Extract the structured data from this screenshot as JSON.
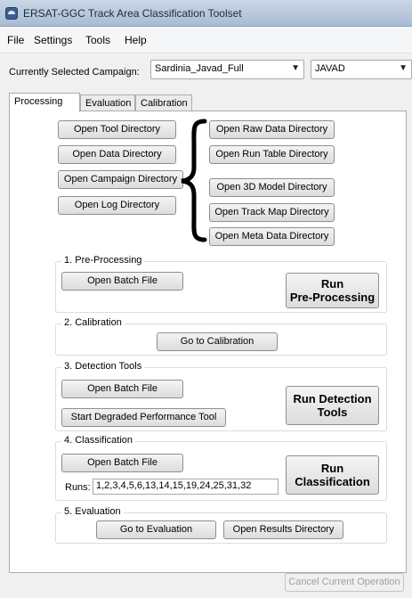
{
  "window": {
    "title": "ERSAT-GGC Track Area Classification Toolset",
    "app_icon": "app-icon"
  },
  "menu": {
    "items": [
      "File",
      "Settings",
      "Tools",
      "Help"
    ]
  },
  "campaign": {
    "label": "Currently Selected Campaign:",
    "selected": "Sardinia_Javad_Full",
    "receiver": "JAVAD"
  },
  "tabs": [
    "Processing",
    "Evaluation",
    "Calibration"
  ],
  "directories": {
    "left": [
      "Open Tool Directory",
      "Open Data Directory",
      "Open Campaign Directory",
      "Open Log Directory"
    ],
    "right": [
      "Open Raw Data Directory",
      "Open Run Table Directory",
      "Open 3D Model Directory",
      "Open Track Map Directory",
      "Open Meta Data Directory"
    ]
  },
  "preprocessing": {
    "title": "1. Pre-Processing",
    "open_batch": "Open Batch File",
    "run": "Run\nPre-Processing"
  },
  "calibration": {
    "title": "2. Calibration",
    "goto": "Go to Calibration"
  },
  "detection": {
    "title": "3. Detection Tools",
    "open_batch": "Open Batch File",
    "degraded": "Start Degraded Performance Tool",
    "run": "Run Detection\nTools"
  },
  "classification": {
    "title": "4. Classification",
    "open_batch": "Open Batch File",
    "runs_label": "Runs:",
    "runs_value": "1,2,3,4,5,6,13,14,15,19,24,25,31,32",
    "run": "Run\nClassification"
  },
  "evaluation": {
    "title": "5. Evaluation",
    "goto": "Go to Evaluation",
    "results": "Open Results Directory"
  },
  "footer": {
    "cancel": "Cancel Current Operation"
  }
}
